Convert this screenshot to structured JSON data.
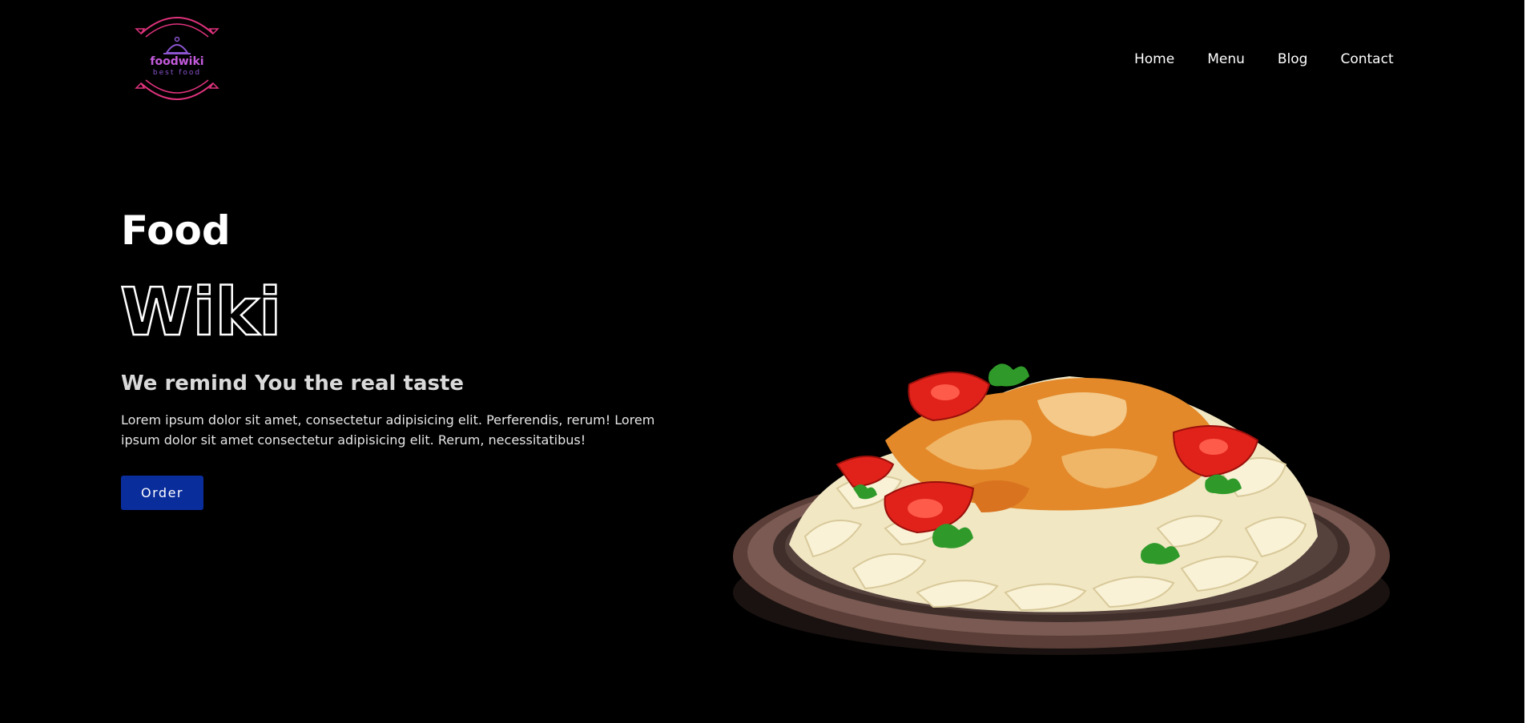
{
  "brand": {
    "logo_text": "foodwiki",
    "logo_subtext": "best food"
  },
  "nav": {
    "items": [
      {
        "label": "Home"
      },
      {
        "label": "Menu"
      },
      {
        "label": "Blog"
      },
      {
        "label": "Contact"
      }
    ]
  },
  "hero": {
    "title": "Food",
    "title_outline": "Wiki",
    "tagline": "We remind You the real taste",
    "description": "Lorem ipsum dolor sit amet, consectetur adipisicing elit. Perferendis, rerum! Lorem ipsum dolor sit amet consectetur adipisicing elit. Rerum, necessitatibus!",
    "order_label": "Order"
  },
  "colors": {
    "background": "#000000",
    "button": "#0a2d9c",
    "logo_pink": "#e0337d",
    "logo_purple": "#8a55cf"
  }
}
